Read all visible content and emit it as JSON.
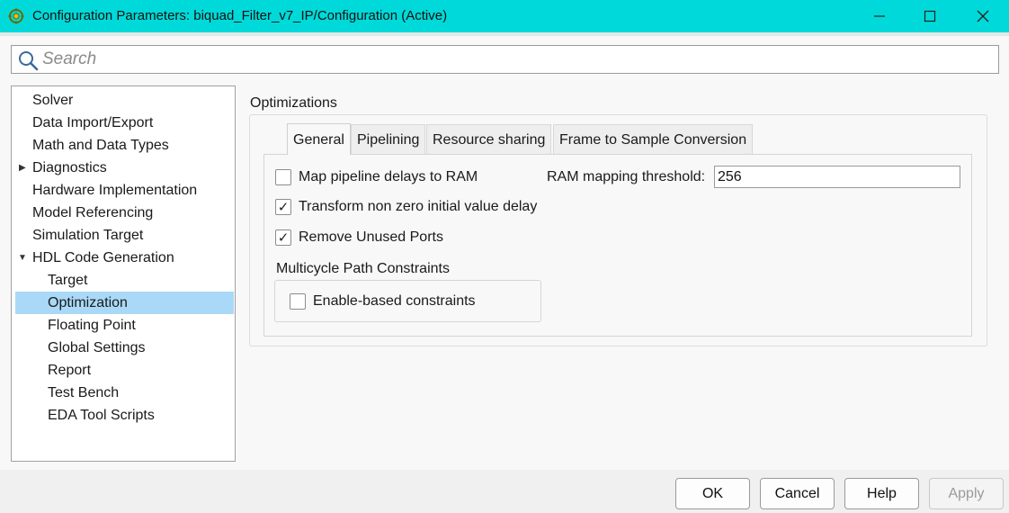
{
  "window": {
    "title": "Configuration Parameters: biquad_Filter_v7_IP/Configuration (Active)",
    "titlebar_color": "#00d9d9"
  },
  "search": {
    "placeholder": "Search",
    "value": ""
  },
  "tree": {
    "items": [
      {
        "label": "Solver",
        "level": 0,
        "expander": ""
      },
      {
        "label": "Data Import/Export",
        "level": 0,
        "expander": ""
      },
      {
        "label": "Math and Data Types",
        "level": 0,
        "expander": ""
      },
      {
        "label": "Diagnostics",
        "level": 0,
        "expander": "collapsed"
      },
      {
        "label": "Hardware Implementation",
        "level": 0,
        "expander": ""
      },
      {
        "label": "Model Referencing",
        "level": 0,
        "expander": ""
      },
      {
        "label": "Simulation Target",
        "level": 0,
        "expander": ""
      },
      {
        "label": "HDL Code Generation",
        "level": 0,
        "expander": "expanded"
      },
      {
        "label": "Target",
        "level": 1,
        "expander": ""
      },
      {
        "label": "Optimization",
        "level": 1,
        "expander": "",
        "selected": true
      },
      {
        "label": "Floating Point",
        "level": 1,
        "expander": ""
      },
      {
        "label": "Global Settings",
        "level": 1,
        "expander": ""
      },
      {
        "label": "Report",
        "level": 1,
        "expander": ""
      },
      {
        "label": "Test Bench",
        "level": 1,
        "expander": ""
      },
      {
        "label": "EDA Tool Scripts",
        "level": 1,
        "expander": ""
      }
    ],
    "selection_color": "#a9d9f7"
  },
  "panel": {
    "title": "Optimizations",
    "tabs": [
      {
        "label": "General",
        "active": true
      },
      {
        "label": "Pipelining",
        "active": false
      },
      {
        "label": "Resource sharing",
        "active": false
      },
      {
        "label": "Frame to Sample Conversion",
        "active": false
      }
    ],
    "general": {
      "map_pipeline": {
        "label": "Map pipeline delays to RAM",
        "checked": false
      },
      "ram_threshold": {
        "label": "RAM mapping threshold:",
        "value": "256"
      },
      "transform_delay": {
        "label": "Transform non zero initial value delay",
        "checked": true
      },
      "remove_ports": {
        "label": "Remove Unused Ports",
        "checked": true
      },
      "multicycle": {
        "title": "Multicycle Path Constraints",
        "enable_based": {
          "label": "Enable-based constraints",
          "checked": false
        }
      }
    }
  },
  "buttons": {
    "ok": "OK",
    "cancel": "Cancel",
    "help": "Help",
    "apply": "Apply"
  }
}
